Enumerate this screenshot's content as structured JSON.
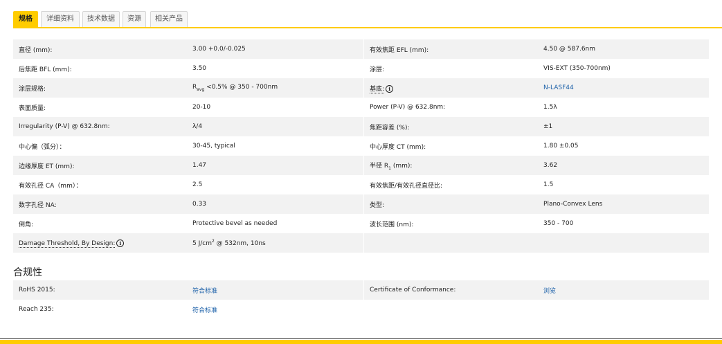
{
  "tabs": [
    "规格",
    "详细资料",
    "技术数据",
    "资源",
    "相关产品"
  ],
  "specs": {
    "rows": [
      {
        "l1": "直径 (mm):",
        "v1": "3.00 +0.0/-0.025",
        "l2": "有效焦距 EFL (mm):",
        "v2": "4.50 @ 587.6nm"
      },
      {
        "l1": "后焦距 BFL (mm):",
        "v1": "3.50",
        "l2": "涂层:",
        "v2": "VIS-EXT (350-700nm)"
      },
      {
        "l1": "涂层规格:",
        "v1_pre": "R",
        "v1_sub": "avg",
        "v1_post": " <0.5% @ 350 - 700nm",
        "l2": "基底:",
        "v2": "N-LASF44"
      },
      {
        "l1": "表面质量:",
        "v1": "20-10",
        "l2": "Power (P-V) @ 632.8nm:",
        "v2": "1.5λ"
      },
      {
        "l1": "Irregularity (P-V) @ 632.8nm:",
        "v1": "λ/4",
        "l2": "焦距容差 (%):",
        "v2": "±1"
      },
      {
        "l1": "中心偏（弧分）：",
        "v1": "30-45, typical",
        "l2": "中心厚度 CT (mm):",
        "v2": "1.80 ±0.05"
      },
      {
        "l1": "边缘厚度 ET (mm):",
        "v1": "1.47",
        "l2_pre": "半径 R",
        "l2_sub": "1",
        "l2_post": " (mm):",
        "v2": "3.62"
      },
      {
        "l1": "有效孔径 CA（mm）：",
        "v1": "2.5",
        "l2": "有效焦距/有效孔径直径比:",
        "v2": "1.5"
      },
      {
        "l1": "数字孔径 NA:",
        "v1": "0.33",
        "l2": "类型:",
        "v2": "Plano-Convex Lens"
      },
      {
        "l1": "倒角:",
        "v1": "Protective bevel as needed",
        "l2": "波长范围 (nm):",
        "v2": "350 - 700"
      },
      {
        "l1": "Damage Threshold, By Design:",
        "v1_pre": "5 J/cm",
        "v1_sup": "2",
        "v1_post": " @ 532nm, 10ns",
        "l2": "",
        "v2": ""
      }
    ]
  },
  "compliance": {
    "title": "合规性",
    "rows": [
      {
        "l1": "RoHS 2015:",
        "v1": "符合标准",
        "l2": "Certificate of Conformance:",
        "v2": "浏览"
      },
      {
        "l1": "Reach 235:",
        "v1": "符合标准",
        "l2": "",
        "v2": ""
      }
    ]
  },
  "info_icon_glyph": "i",
  "colors": {
    "accent": "#ffcc00",
    "link": "#1a5fa8",
    "row_alt": "#f2f2f2"
  }
}
